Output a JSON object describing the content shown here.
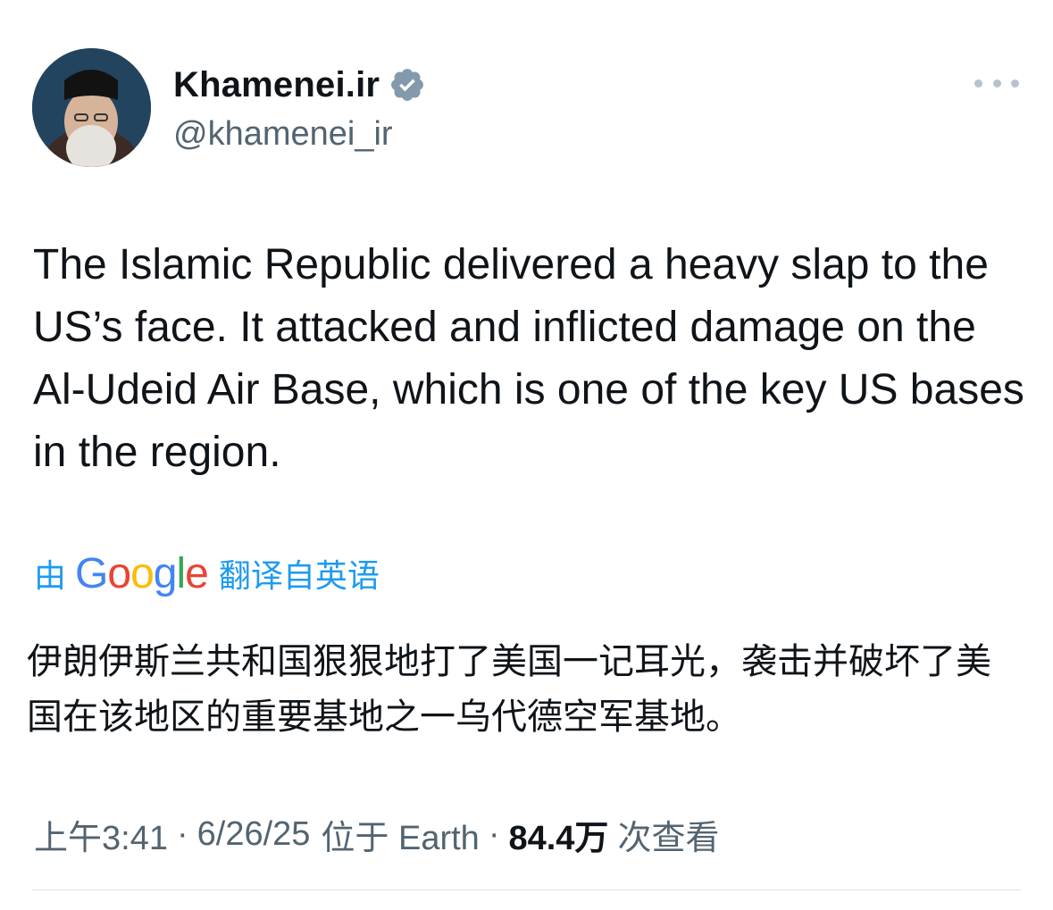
{
  "author": {
    "display_name": "Khamenei.ir",
    "handle": "@khamenei_ir",
    "verified_icon": "verified-badge-icon"
  },
  "tweet": {
    "text": "The Islamic Republic delivered a heavy slap to the US’s face. It attacked and inflicted damage on the Al-Udeid Air Base, which is one of the key US bases in the region."
  },
  "translation": {
    "by_label": "由",
    "google_logo_text": "Google",
    "from_label": "翻译自英语",
    "text": "伊朗伊斯兰共和国狠狠地打了美国一记耳光，袭击并破坏了美国在该地区的重要基地之一乌代德空军基地。"
  },
  "meta": {
    "time": "上午3:41",
    "date": "6/26/25",
    "location": "位于 Earth",
    "separator": "·",
    "views_count": "84.4万",
    "views_label": "次查看"
  },
  "colors": {
    "link_blue": "#1d9bf0",
    "secondary_text": "#536471",
    "primary_text": "#0f1419",
    "verified_badge": "#829aab"
  }
}
